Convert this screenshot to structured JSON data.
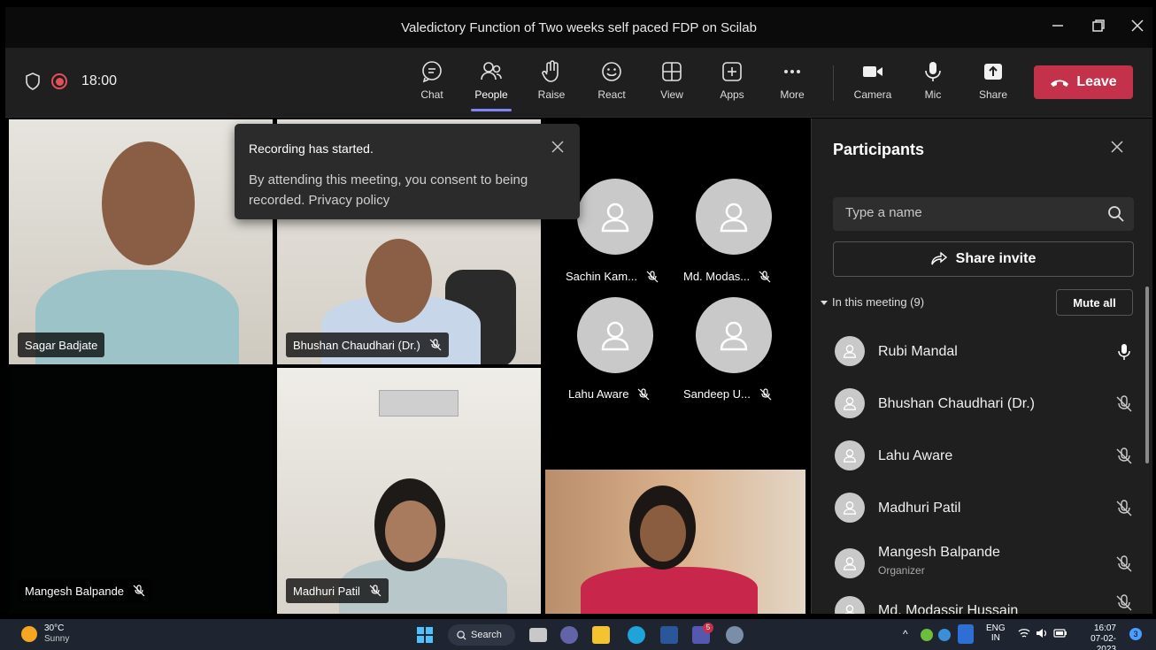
{
  "window": {
    "title": "Valedictory Function of Two weeks self paced FDP on Scilab"
  },
  "toolbar": {
    "timer": "18:00",
    "buttons": [
      {
        "label": "Chat",
        "icon": "chat-icon"
      },
      {
        "label": "People",
        "icon": "people-icon",
        "active": true
      },
      {
        "label": "Raise",
        "icon": "raise-hand-icon"
      },
      {
        "label": "React",
        "icon": "react-icon"
      },
      {
        "label": "View",
        "icon": "view-icon"
      },
      {
        "label": "Apps",
        "icon": "apps-icon"
      },
      {
        "label": "More",
        "icon": "more-icon"
      },
      {
        "label": "Camera",
        "icon": "camera-icon"
      },
      {
        "label": "Mic",
        "icon": "mic-icon"
      },
      {
        "label": "Share",
        "icon": "share-icon"
      }
    ],
    "leave_label": "Leave",
    "leave_color": "#c4314b"
  },
  "toast": {
    "title": "Recording has started.",
    "body": "By attending this meeting, you consent to being recorded. Privacy policy"
  },
  "videos": [
    {
      "name": "Sagar Badjate"
    },
    {
      "name": "Bhushan Chaudhari (Dr.)"
    },
    {
      "name": "Mangesh Balpande"
    },
    {
      "name": "Madhuri Patil"
    }
  ],
  "avatars": [
    {
      "name": "Sachin Kam..."
    },
    {
      "name": "Md. Modas..."
    },
    {
      "name": "Lahu Aware"
    },
    {
      "name": "Sandeep U..."
    }
  ],
  "panel": {
    "title": "Participants",
    "search_placeholder": "Type a name",
    "share_invite": "Share invite",
    "section": "In this meeting (9)",
    "mute_all": "Mute all",
    "participants": [
      {
        "name": "Rubi Mandal",
        "role": "",
        "mic": "on"
      },
      {
        "name": "Bhushan Chaudhari (Dr.)",
        "role": "",
        "mic": "off"
      },
      {
        "name": "Lahu Aware",
        "role": "",
        "mic": "off"
      },
      {
        "name": "Madhuri Patil",
        "role": "",
        "mic": "off"
      },
      {
        "name": "Mangesh Balpande",
        "role": "Organizer",
        "mic": "off"
      },
      {
        "name": "Md. Modassir Hussain",
        "role": "",
        "mic": "off"
      }
    ]
  },
  "taskbar": {
    "temp": "30°C",
    "weather": "Sunny",
    "search": "Search",
    "lang_top": "ENG",
    "lang_bottom": "IN",
    "time": "16:07",
    "date": "07-02-2023",
    "notifications": "3",
    "teams_badge": "5"
  }
}
